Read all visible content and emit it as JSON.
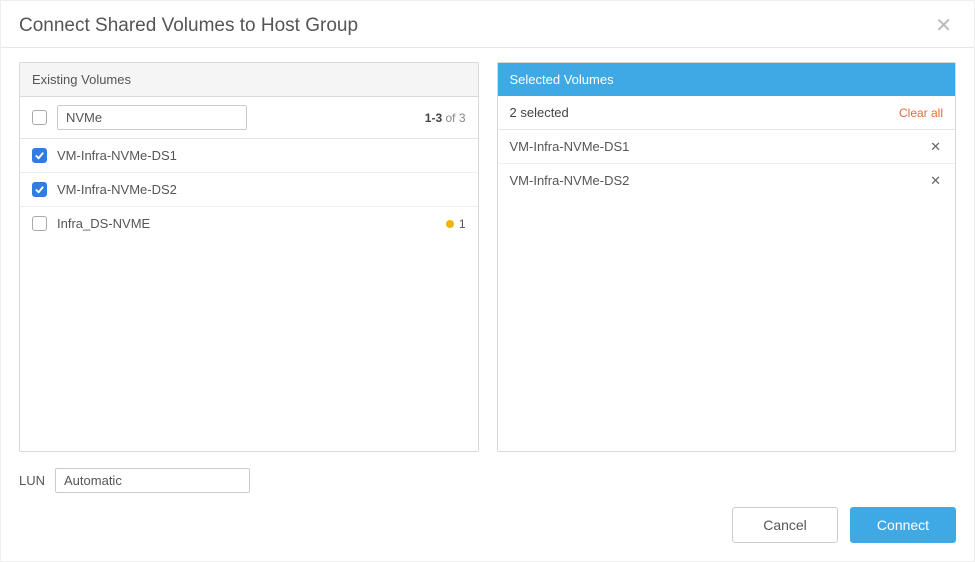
{
  "dialog": {
    "title": "Connect Shared Volumes to Host Group"
  },
  "existing": {
    "header": "Existing Volumes",
    "search_value": "NVMe",
    "count_prefix": "1-3",
    "count_of": " of ",
    "count_total": "3",
    "rows": [
      {
        "name": "VM-Infra-NVMe-DS1",
        "checked": true,
        "badge": null
      },
      {
        "name": "VM-Infra-NVMe-DS2",
        "checked": true,
        "badge": null
      },
      {
        "name": "Infra_DS-NVME",
        "checked": false,
        "badge": "1"
      }
    ]
  },
  "selected": {
    "header": "Selected Volumes",
    "summary": "2 selected",
    "clear_all": "Clear all",
    "rows": [
      {
        "name": "VM-Infra-NVMe-DS1"
      },
      {
        "name": "VM-Infra-NVMe-DS2"
      }
    ]
  },
  "lun": {
    "label": "LUN",
    "value": "Automatic"
  },
  "footer": {
    "cancel": "Cancel",
    "connect": "Connect"
  }
}
